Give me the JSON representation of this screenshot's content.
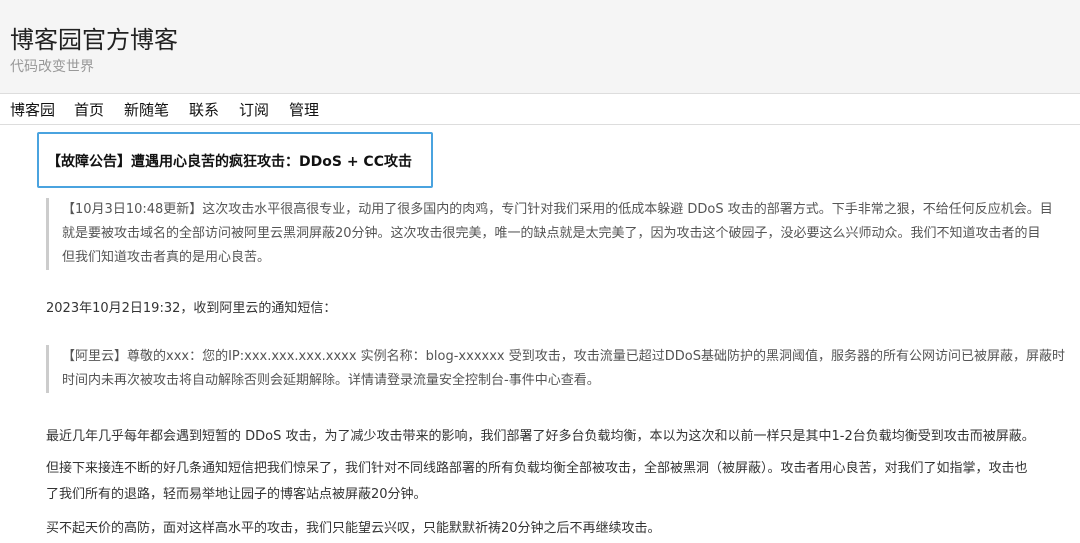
{
  "header": {
    "title": "博客园官方博客",
    "subtitle": "代码改变世界"
  },
  "nav": {
    "items": [
      "博客园",
      "首页",
      "新随笔",
      "联系",
      "订阅",
      "管理"
    ]
  },
  "post": {
    "title": "【故障公告】遭遇用心良苦的疯狂攻击：DDoS + CC攻击",
    "update_quote": [
      "【10月3日10:48更新】这次攻击水平很高很专业，动用了很多国内的肉鸡，专门针对我们采用的低成本躲避 DDoS 攻击的部署方式。下手非常之狠，不给任何反应机会。目",
      "就是要被攻击域名的全部访问被阿里云黑洞屏蔽20分钟。这次攻击很完美，唯一的缺点就是太完美了，因为攻击这个破园子，没必要这么兴师动众。我们不知道攻击者的目",
      "但我们知道攻击者真的是用心良苦。"
    ],
    "sms_intro": "2023年10月2日19:32，收到阿里云的通知短信：",
    "sms_quote": [
      "【阿里云】尊敬的xxx：您的IP:xxx.xxx.xxx.xxxx 实例名称：blog-xxxxxx 受到攻击，攻击流量已超过DDoS基础防护的黑洞阈值，服务器的所有公网访问已被屏蔽，屏蔽时",
      "时间内未再次被攻击将自动解除否则会延期解除。详情请登录流量安全控制台-事件中心查看。"
    ],
    "para1": "最近几年几乎每年都会遇到短暂的 DDoS 攻击，为了减少攻击带来的影响，我们部署了好多台负载均衡，本以为这次和以前一样只是其中1-2台负载均衡受到攻击而被屏蔽。",
    "para2": [
      "但接下来接连不断的好几条通知短信把我们惊呆了，我们针对不同线路部署的所有负载均衡全部被攻击，全部被黑洞（被屏蔽）。攻击者用心良苦，对我们了如指掌，攻击也",
      "了我们所有的退路，轻而易举地让园子的博客站点被屏蔽20分钟。"
    ],
    "para3": "买不起天价的高防，面对这样高水平的攻击，我们只能望云兴叹，只能默默祈祷20分钟之后不再继续攻击。"
  }
}
